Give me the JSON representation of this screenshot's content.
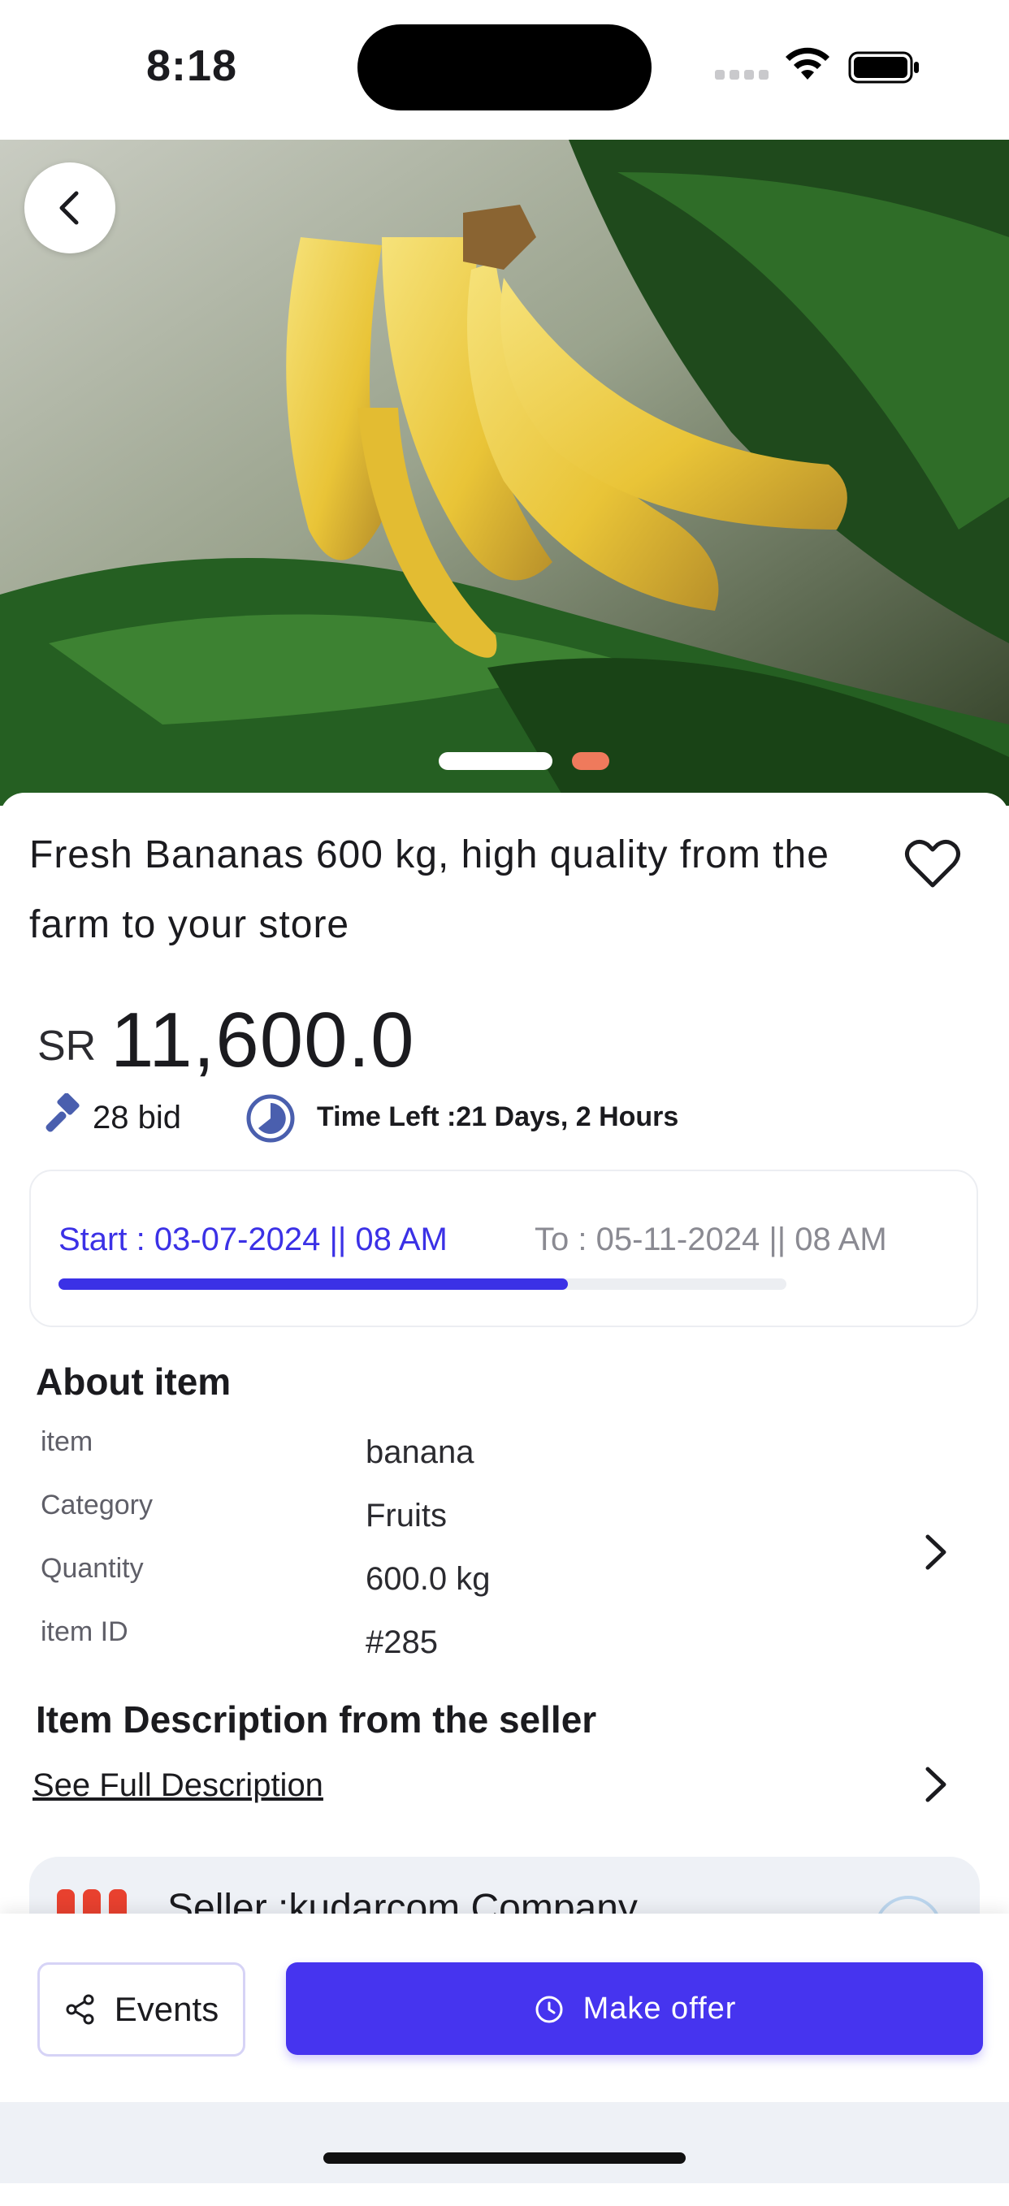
{
  "status_bar": {
    "time": "8:18"
  },
  "product": {
    "title": "Fresh Bananas  600 kg, high quality from the farm to your store",
    "currency": "SR",
    "price": "11,600.0",
    "bids": "28 bid",
    "time_left": "Time Left :21 Days, 2 Hours",
    "start": "Start : 03-07-2024 || 08 AM",
    "end": "To : 05-11-2024 || 08 AM",
    "auction_progress": 0.7
  },
  "about": {
    "heading": "About item",
    "rows": [
      {
        "label": "item",
        "value": "banana"
      },
      {
        "label": "Category",
        "value": "Fruits"
      },
      {
        "label": "Quantity",
        "value": "600.0 kg"
      },
      {
        "label": "item ID",
        "value": "#285"
      }
    ]
  },
  "description": {
    "heading": "Item Description from the seller",
    "link": "See Full Description"
  },
  "seller": {
    "name": "Seller :kudarcom Company"
  },
  "actions": {
    "events_label": "Events",
    "offer_label": "Make offer"
  },
  "colors": {
    "accent": "#4634ef",
    "pager_active": "#ef7a5c",
    "progress": "#3b31e6"
  },
  "icons": [
    "back-arrow-icon",
    "heart-icon",
    "gavel-icon",
    "clock-icon",
    "chevron-right-icon",
    "share-icon",
    "timer-icon"
  ]
}
